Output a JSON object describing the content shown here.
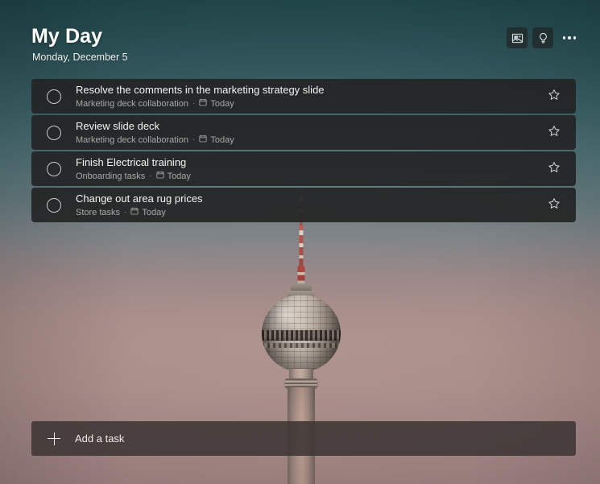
{
  "header": {
    "title": "My Day",
    "date": "Monday, December 5",
    "actions": [
      {
        "name": "change-background-button",
        "icon": "picture-icon"
      },
      {
        "name": "suggestions-button",
        "icon": "lightbulb-icon"
      },
      {
        "name": "more-options-button",
        "icon": "ellipsis-icon"
      }
    ]
  },
  "tasks": [
    {
      "title": "Resolve the comments in the marketing strategy slide",
      "list": "Marketing deck collaboration",
      "separator": "·",
      "due": "Today",
      "completed": false,
      "starred": false
    },
    {
      "title": "Review slide deck",
      "list": "Marketing deck collaboration",
      "separator": "·",
      "due": "Today",
      "completed": false,
      "starred": false
    },
    {
      "title": "Finish Electrical training",
      "list": "Onboarding tasks",
      "separator": "·",
      "due": "Today",
      "completed": false,
      "starred": false
    },
    {
      "title": "Change out area rug prices",
      "list": "Store tasks",
      "separator": "·",
      "due": "Today",
      "completed": false,
      "starred": false
    }
  ],
  "add_task": {
    "label": "Add a task",
    "icon": "plus-icon"
  },
  "colors": {
    "card_background": "#222222",
    "add_task_background": "#3e3634",
    "title_text": "#ffffff",
    "meta_text": "#a8a8a8",
    "sky_top": "#1d4245",
    "sky_bottom": "#a98b89"
  }
}
